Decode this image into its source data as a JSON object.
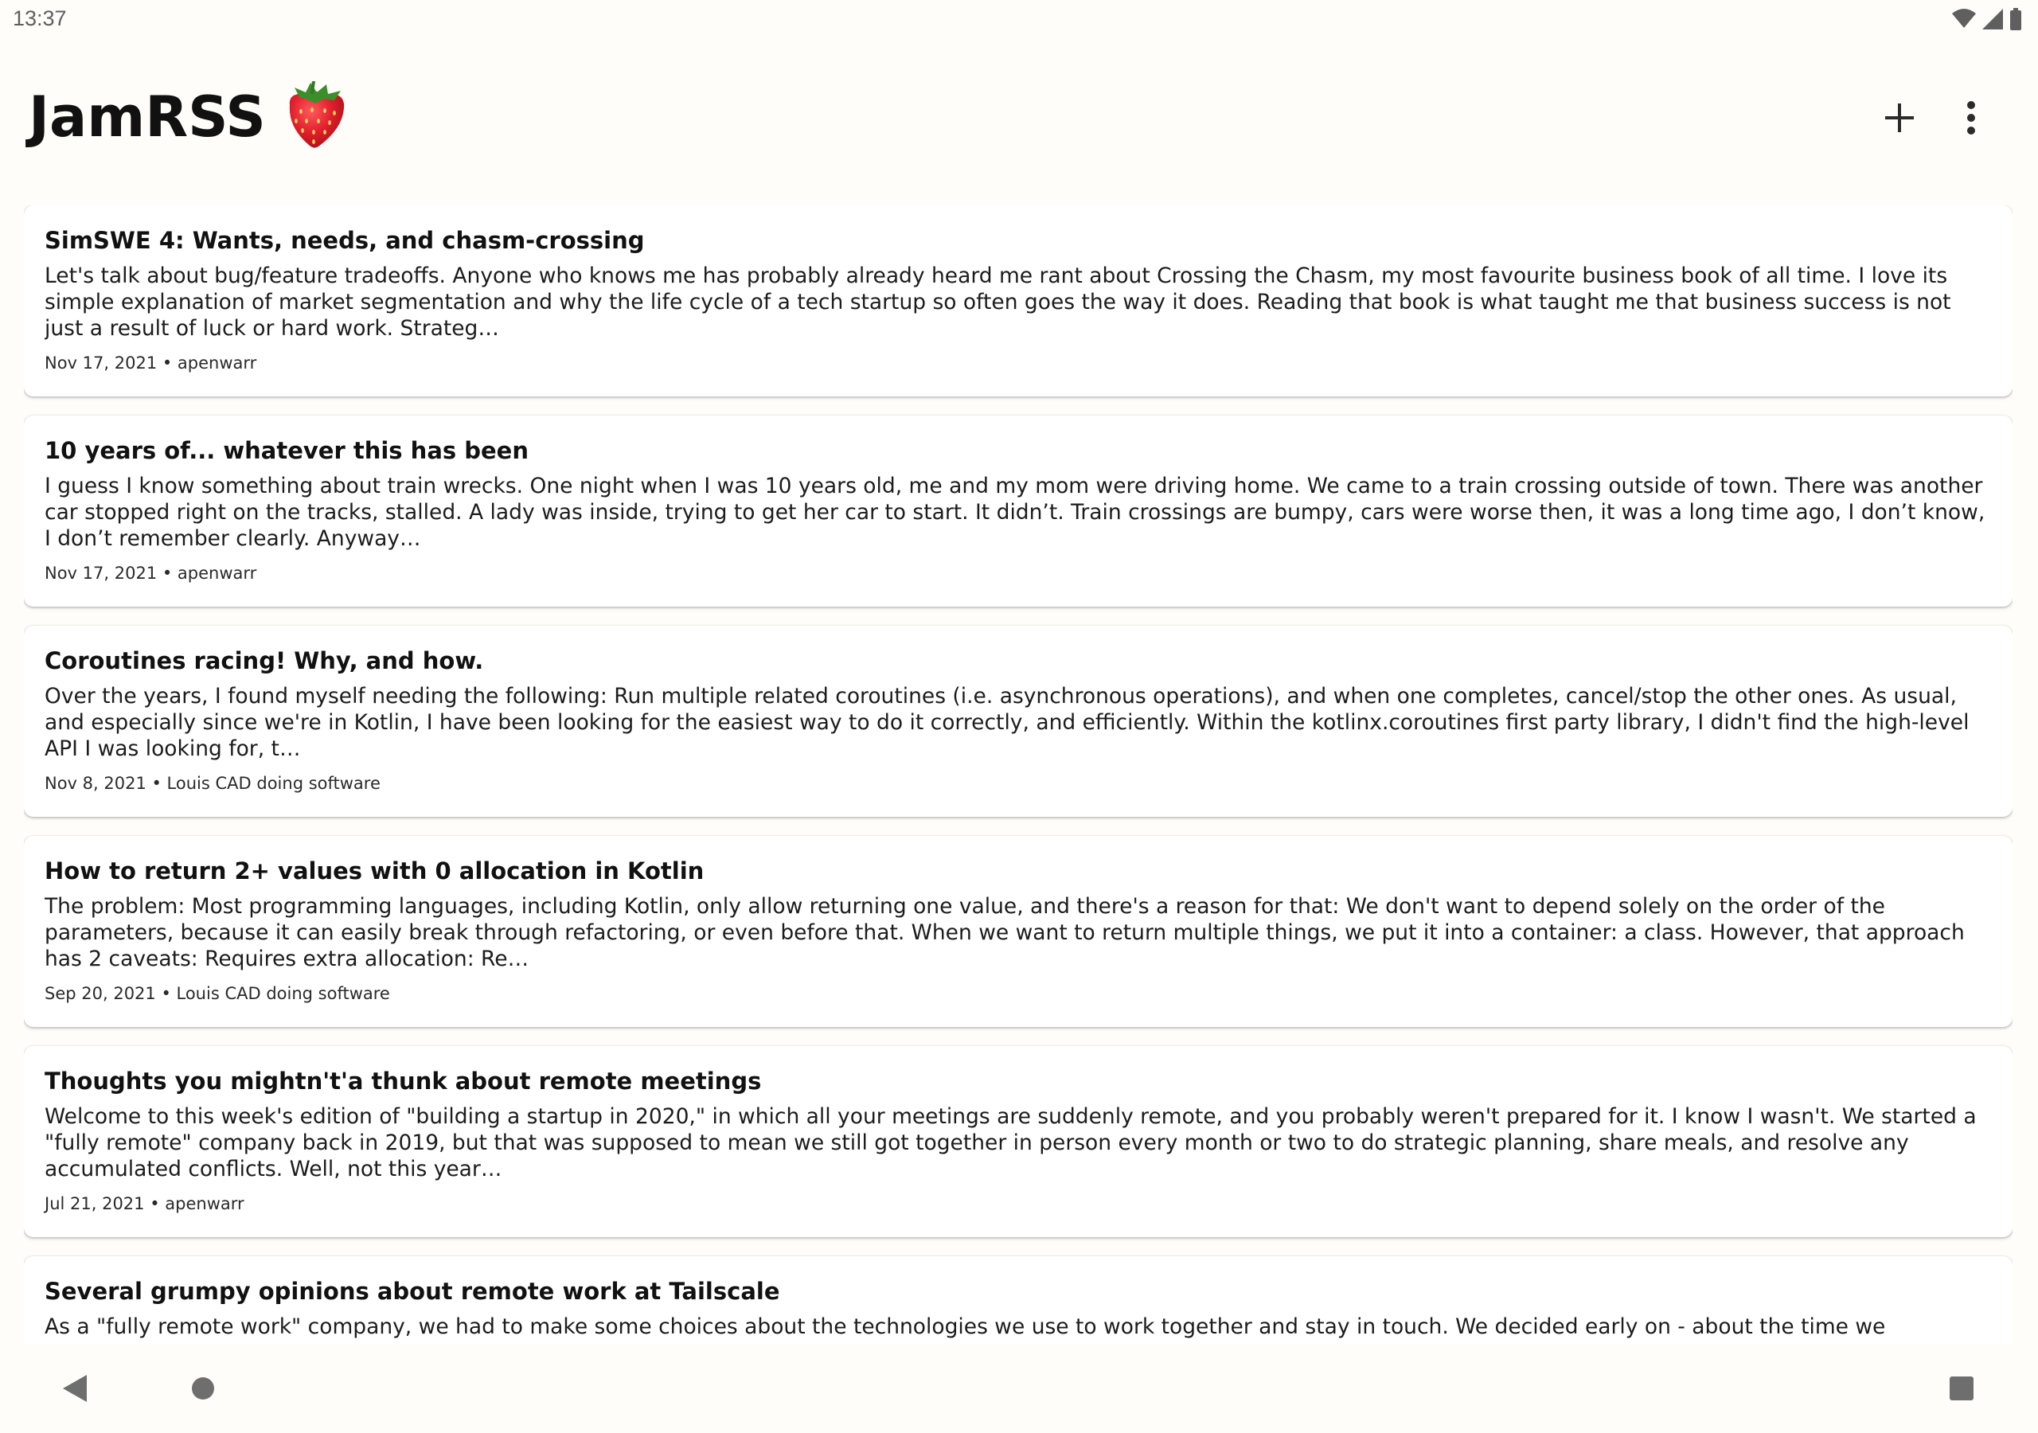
{
  "status_bar": {
    "time": "13:37",
    "icons": [
      "wifi-icon",
      "cellular-signal-icon",
      "battery-icon"
    ]
  },
  "app_bar": {
    "title": "JamRSS",
    "logo_emoji": "🍓",
    "actions": [
      {
        "name": "add-feed-button",
        "icon": "plus-icon"
      },
      {
        "name": "more-options-button",
        "icon": "more-vertical-icon"
      }
    ]
  },
  "articles": [
    {
      "title": "SimSWE 4: Wants, needs, and chasm-crossing",
      "excerpt": "Let's talk about bug/feature tradeoffs. Anyone who knows me has probably already heard me rant about Crossing the Chasm, my most favourite business book of all time. I love its simple explanation of market segmentation and why the life cycle of a tech startup so often goes the way it does. Reading that book is what taught me that business success is not just a result of luck or hard work. Strateg…",
      "meta": "Nov 17, 2021 • apenwarr"
    },
    {
      "title": "10 years of... whatever this has been",
      "excerpt": "I guess I know something about train wrecks. One night when I was 10 years old, me and my mom were driving home. We came to a train crossing outside of town. There was another car stopped right on the tracks, stalled. A lady was inside, trying to get her car to start. It didn’t. Train crossings are bumpy, cars were worse then, it was a long time ago, I don’t know, I don’t remember clearly. Anyway…",
      "meta": "Nov 17, 2021 • apenwarr"
    },
    {
      "title": "Coroutines racing! Why, and how.",
      "excerpt": "Over the years, I found myself needing the following: Run multiple related coroutines (i.e. asynchronous operations), and when one completes, cancel/stop the other ones. As usual, and especially since we're in Kotlin, I have been looking for the easiest way to do it correctly, and efficiently. Within the kotlinx.coroutines first party library, I didn't find the high-level API I was looking for, t…",
      "meta": "Nov 8, 2021 • Louis CAD doing software"
    },
    {
      "title": "How to return 2+ values with 0 allocation in Kotlin",
      "excerpt": "The problem: Most programming languages, including Kotlin, only allow returning one value, and there's a reason for that: We don't want to depend solely on the order of the parameters, because it can easily break through refactoring, or even before that. When we want to return multiple things, we put it into a container: a class. However, that approach has 2 caveats: Requires extra allocation: Re…",
      "meta": "Sep 20, 2021 • Louis CAD doing software"
    },
    {
      "title": "Thoughts you mightn't'a thunk about remote meetings",
      "excerpt": "Welcome to this week's edition of \"building a startup in 2020,\" in which all your meetings are suddenly remote, and you probably weren't prepared for it. I know I wasn't. We started a \"fully remote\" company back in 2019, but that was supposed to mean we still got together in person every month or two to do strategic planning, share meals, and resolve any accumulated conflicts. Well, not this year…",
      "meta": "Jul 21, 2021 • apenwarr"
    },
    {
      "title": "Several grumpy opinions about remote work at Tailscale",
      "excerpt": "As a \"fully remote work\" company, we had to make some choices about the technologies we use to work together and stay in touch. We decided early on - about the time we",
      "meta": ""
    }
  ],
  "nav_bar": {
    "buttons": [
      "back-icon",
      "home-icon",
      "recents-icon"
    ]
  },
  "colors": {
    "background": "#fefdfa",
    "card": "#ffffff",
    "text": "#141414",
    "icon": "#2b2b2b",
    "nav_icon": "#6e6e6e"
  }
}
